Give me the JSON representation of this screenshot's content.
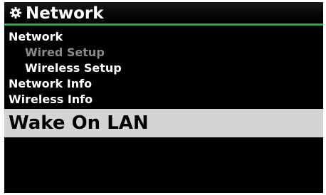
{
  "header": {
    "title": "Network",
    "icon": "gear-icon",
    "accent_color": "#2fa44a"
  },
  "menu": {
    "items": [
      {
        "label": "Network",
        "level": 0,
        "state": "normal"
      },
      {
        "label": "Wired Setup",
        "level": 1,
        "state": "disabled"
      },
      {
        "label": "Wireless Setup",
        "level": 1,
        "state": "normal"
      },
      {
        "label": "Network Info",
        "level": 0,
        "state": "normal"
      },
      {
        "label": "Wireless Info",
        "level": 0,
        "state": "normal"
      },
      {
        "label": "Wake On LAN",
        "level": 0,
        "state": "selected"
      }
    ]
  },
  "colors": {
    "background": "#000000",
    "text": "#ffffff",
    "disabled_text": "#8a8a8a",
    "selection_bg": "#d4d4d4",
    "selection_text": "#000000"
  }
}
